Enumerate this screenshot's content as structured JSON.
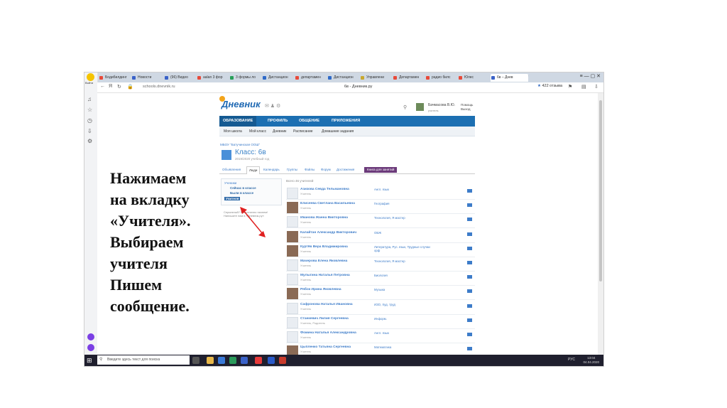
{
  "colors": {
    "accent": "#1c6fb2",
    "link": "#3d7cc9",
    "class_btn": "#6b3a7a",
    "yandex_purple": "#7b3fe4"
  },
  "browser": {
    "tabs": [
      {
        "label": "Бодибилдинг",
        "icon_color": "#e84a3a"
      },
      {
        "label": "Новости",
        "icon_color": "#3a62c8"
      },
      {
        "label": "(96) Видео",
        "icon_color": "#3a62c8"
      },
      {
        "label": "aalan 3 фор",
        "icon_color": "#e84a3a"
      },
      {
        "label": "3 формы ло",
        "icon_color": "#2aa05a"
      },
      {
        "label": "Дистанцион",
        "icon_color": "#2f6ac8"
      },
      {
        "label": "департамен",
        "icon_color": "#e84a3a"
      },
      {
        "label": "Дистанцион",
        "icon_color": "#2f6ac8"
      },
      {
        "label": "Управлени",
        "icon_color": "#c8a82f"
      },
      {
        "label": "Департамен",
        "icon_color": "#e84a3a"
      },
      {
        "label": "радио билс",
        "icon_color": "#e84a3a"
      },
      {
        "label": "Юлес",
        "icon_color": "#e84a3a"
      },
      {
        "label": "6в – Днев",
        "icon_color": "#3a62c8"
      }
    ],
    "new_tab": "+",
    "window_controls": "≡  —  ▢  ✕",
    "sidebar_user": "Войти",
    "url": "schools.dnevnik.ru",
    "page_title": "6в - Дневник.ру",
    "reviews": "422 отзыва"
  },
  "site": {
    "logo": "Дневник",
    "user_name": "Бачмасова В.Ю.",
    "user_role": "учитель",
    "help": "Помощь",
    "logout": "Выход",
    "main_nav": [
      "ОБРАЗОВАНИЕ",
      "ПРОФИЛЬ",
      "ОБЩЕНИЕ",
      "ПРИЛОЖЕНИЯ"
    ],
    "sub_nav": [
      "Моя школа",
      "Мой класс",
      "Дневник",
      "Расписание",
      "Домашние задания"
    ],
    "school": "МБОУ \"Батучинская ООШ\"",
    "class_title": "Класс: 6в",
    "class_year": "2019/2020 учебный год",
    "class_tabs": [
      "Объявления",
      "Люди",
      "Календарь",
      "Группы",
      "Файлы",
      "Форум",
      "Достижения"
    ],
    "class_button": "Книга для занятий",
    "side_menu": {
      "students": "Ученики",
      "now_in_class": "Сейчас в классе",
      "were_in_class": "Были в классе",
      "teachers": "Учителя"
    },
    "side_note": "Серьезный? Мы отлично начнем! Напишите нам в «Дневник.ру»",
    "total": "Всего 46 учителей",
    "teachers": [
      {
        "name": "Азизова Севда Тельмановна",
        "role": "Учитель",
        "subject": "Англ. язык",
        "photo": false
      },
      {
        "name": "Елисеева Светлана Васильевна",
        "role": "Учитель",
        "subject": "География",
        "photo": true
      },
      {
        "name": "Иванова Жанна Викторовна",
        "role": "Учитель",
        "subject": "Технология, Я мастер",
        "photo": false
      },
      {
        "name": "Калайтан Александр Викторович",
        "role": "Учитель",
        "subject": "ОБЖ",
        "photo": true
      },
      {
        "name": "Куртёв Вера Владимировна",
        "role": "Учитель",
        "subject": "Литература, Рус. язык, Трудные случаи орф",
        "photo": true
      },
      {
        "name": "Мачерова Елена Яковлевна",
        "role": "Учитель",
        "subject": "Технология, Я мастер",
        "photo": false
      },
      {
        "name": "Мулыгина Наталья Петровна",
        "role": "Учитель",
        "subject": "Биология",
        "photo": false
      },
      {
        "name": "Рябок Ирина Яковлевна",
        "role": "Учитель",
        "subject": "Музыка",
        "photo": true
      },
      {
        "name": "Сафронова Наталья Ивановна",
        "role": "Учитель",
        "subject": "ИЗО, Худ. труд",
        "photo": false
      },
      {
        "name": "Станкевич Лилия Сергеевна",
        "role": "Учитель, Родитель",
        "subject": "Информ.",
        "photo": false
      },
      {
        "name": "Фомина Наталья Александровна",
        "role": "Учитель",
        "subject": "Англ. язык",
        "photo": false
      },
      {
        "name": "Цыпленко Татьяна Сергеевна",
        "role": "Учитель",
        "subject": "Математика",
        "photo": true
      }
    ]
  },
  "overlay": {
    "lines": [
      "Нажимаем",
      "на вкладку",
      "«Учителя».",
      "Выбираем",
      "учителя",
      "Пишем",
      "сообщение."
    ]
  },
  "taskbar": {
    "search_placeholder": "Введите здесь текст для поиска",
    "lang": "РУС",
    "time": "13:04",
    "date": "04.04.2020"
  }
}
